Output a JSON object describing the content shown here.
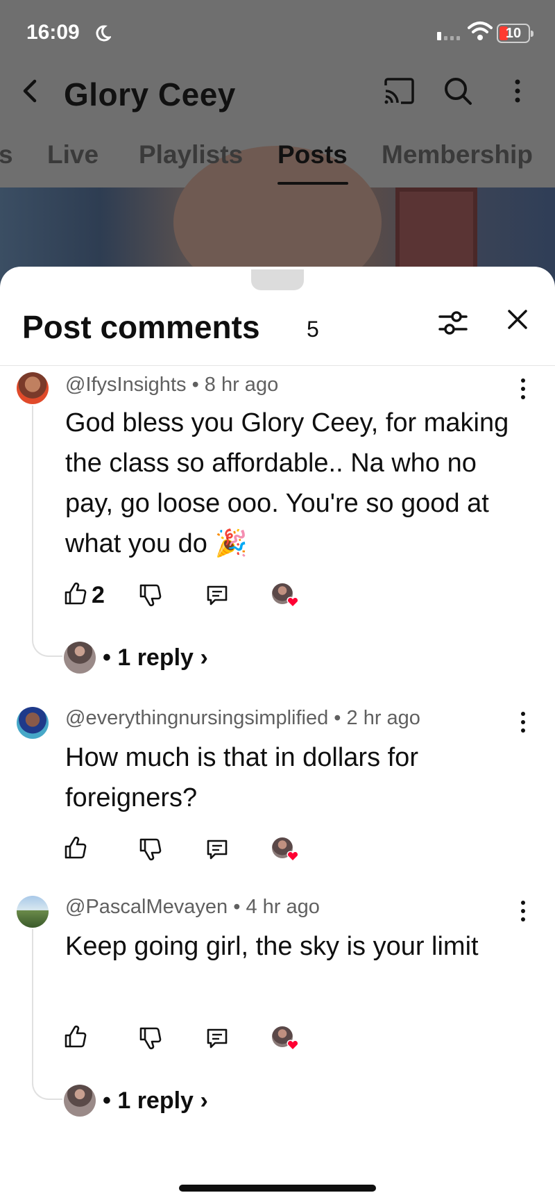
{
  "status_bar": {
    "time": "16:09",
    "battery": "10"
  },
  "app_bar": {
    "channel_title": "Glory Ceey"
  },
  "tabs": [
    {
      "label": "s"
    },
    {
      "label": "Live"
    },
    {
      "label": "Playlists"
    },
    {
      "label": "Posts",
      "active": true
    },
    {
      "label": "Membership"
    }
  ],
  "sheet": {
    "title": "Post comments",
    "count": "5"
  },
  "comments": [
    {
      "author": "@IfysInsights",
      "age": "8 hr ago",
      "text": "God bless you Glory Ceey, for making the class so affordable.. Na who no pay, go loose ooo. You're so good at what you do 🎉",
      "likes": "2",
      "creator_heart": true,
      "replies": "• 1 reply"
    },
    {
      "author": "@everythingnursingsimplified",
      "age": "2 hr ago",
      "text": "How much is that in dollars for foreigners?",
      "likes": "",
      "creator_heart": true
    },
    {
      "author": "@PascalMevayen",
      "age": "4 hr ago",
      "text": "Keep going girl, the sky is your limit",
      "likes": "",
      "creator_heart": true,
      "replies": "• 1 reply"
    }
  ],
  "colors": {
    "heart": "#ff0033",
    "dim_overlay": "#6f6f6f",
    "meta_text": "#606060"
  }
}
